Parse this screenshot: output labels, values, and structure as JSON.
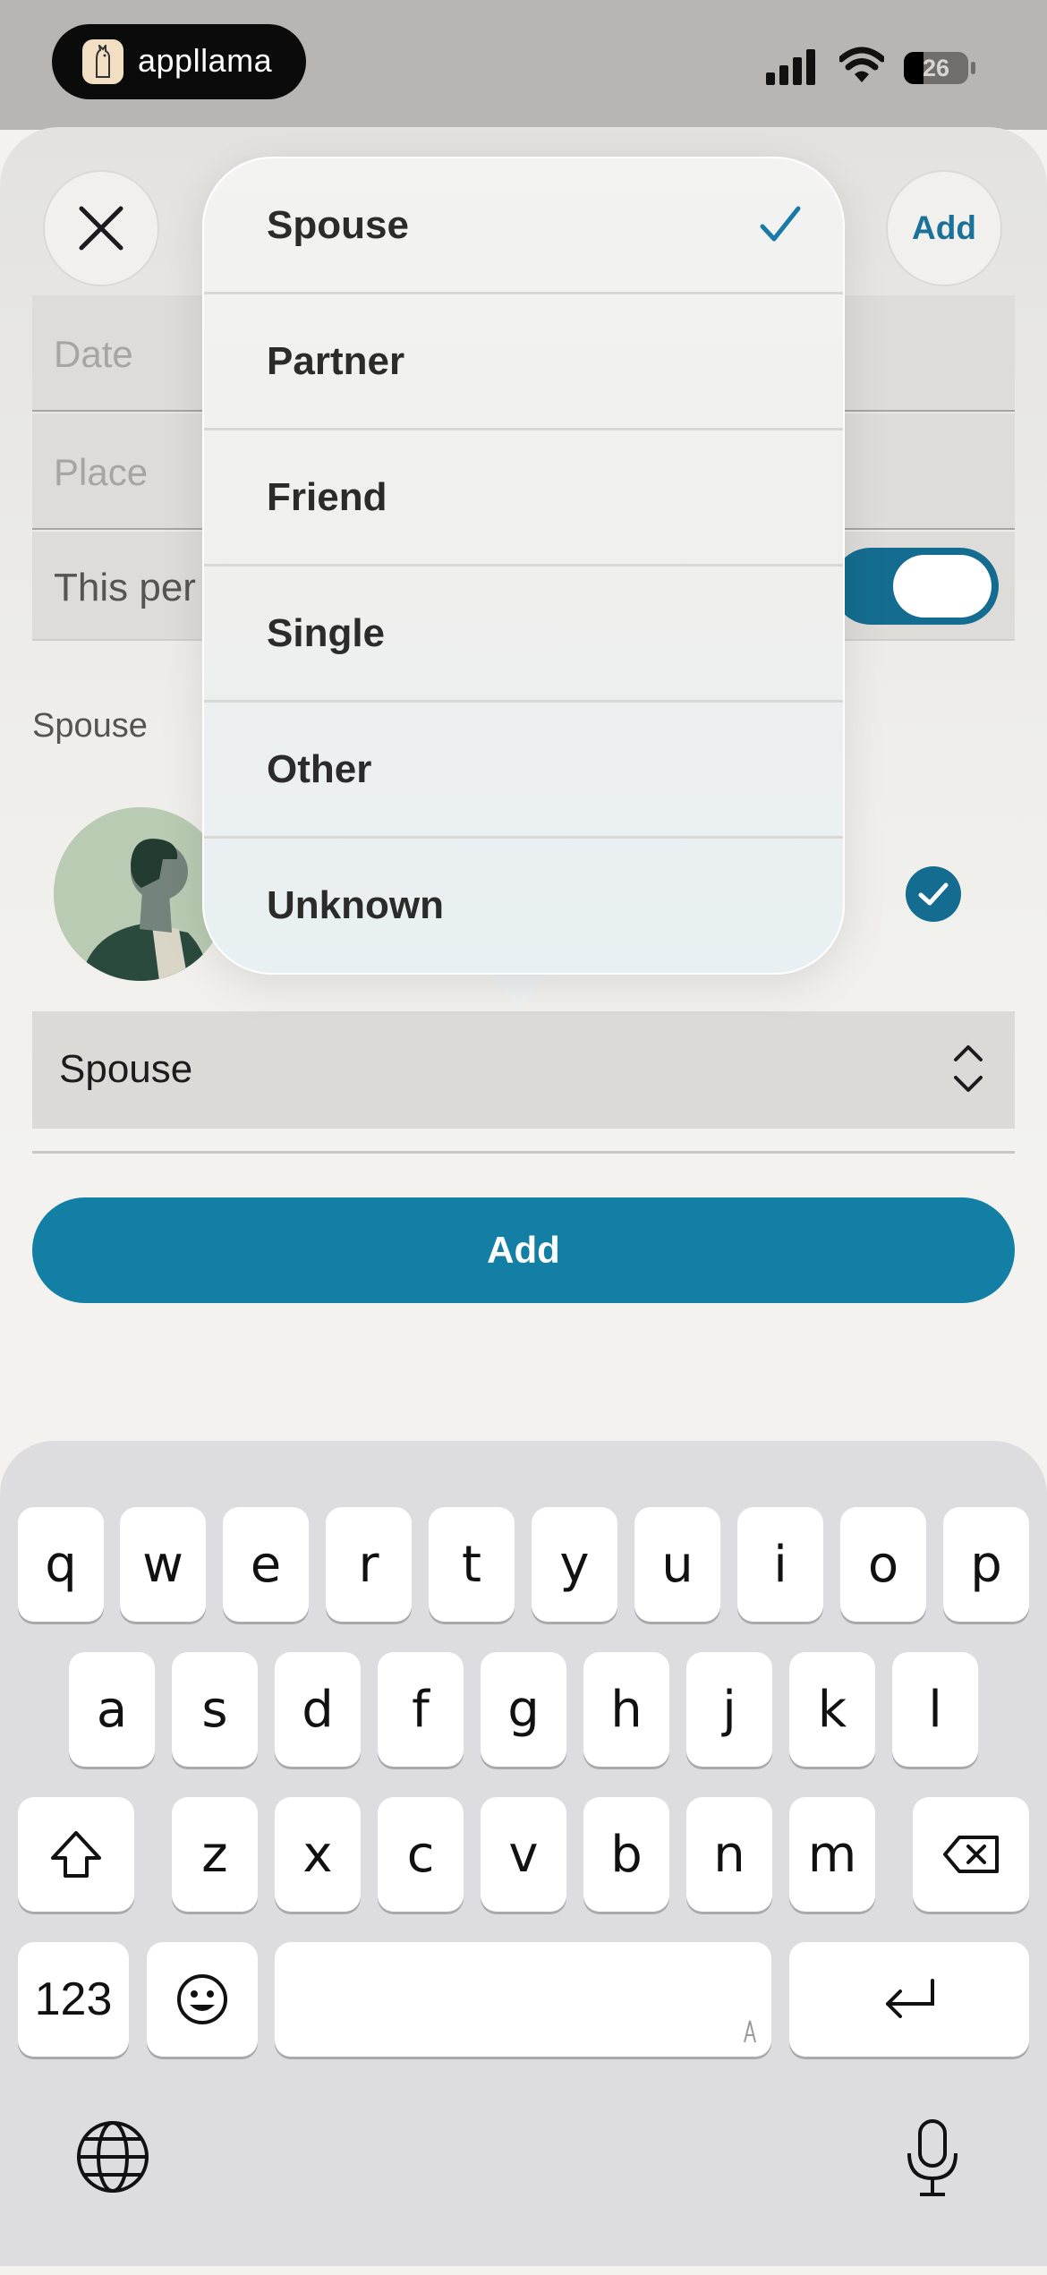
{
  "status_bar": {
    "app_name": "appllama",
    "battery": "26"
  },
  "header": {
    "add_label": "Add"
  },
  "form": {
    "date_placeholder": "Date",
    "place_placeholder": "Place",
    "toggle_label": "This per",
    "spouse_heading": "Spouse",
    "relationship_value": "Spouse",
    "add_button": "Add"
  },
  "dropdown": {
    "options": [
      "Spouse",
      "Partner",
      "Friend",
      "Single",
      "Other",
      "Unknown"
    ],
    "selected": "Spouse"
  },
  "keyboard": {
    "row1": [
      "q",
      "w",
      "e",
      "r",
      "t",
      "y",
      "u",
      "i",
      "o",
      "p"
    ],
    "row2": [
      "a",
      "s",
      "d",
      "f",
      "g",
      "h",
      "j",
      "k",
      "l"
    ],
    "row3": [
      "z",
      "x",
      "c",
      "v",
      "b",
      "n",
      "m"
    ],
    "numbers_key": "123"
  },
  "colors": {
    "accent": "#137fa5",
    "toggle_on": "#146d90"
  }
}
